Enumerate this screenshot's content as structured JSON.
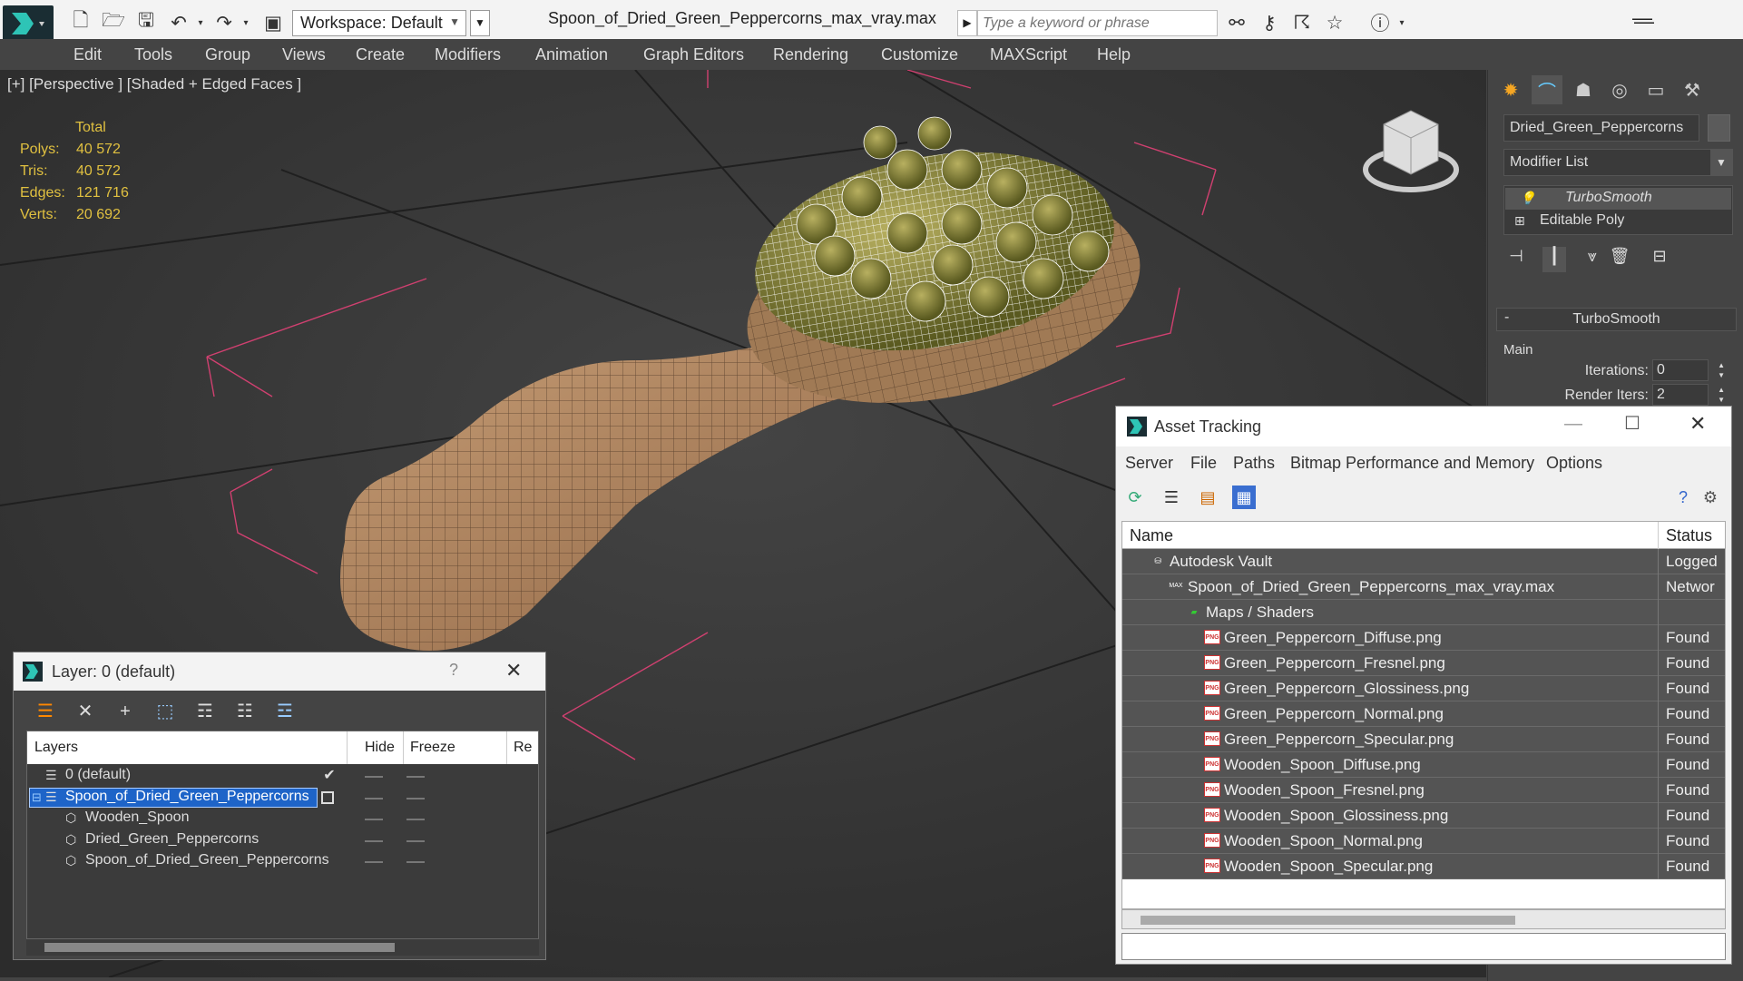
{
  "app": {
    "file_title": "Spoon_of_Dried_Green_Peppercorns_max_vray.max",
    "workspace": "Workspace: Default",
    "search_placeholder": "Type a keyword or phrase"
  },
  "menu": [
    "Edit",
    "Tools",
    "Group",
    "Views",
    "Create",
    "Modifiers",
    "Animation",
    "Graph Editors",
    "Rendering",
    "Customize",
    "MAXScript",
    "Help"
  ],
  "viewport": {
    "label": "[+] [Perspective ] [Shaded + Edged Faces ]",
    "stats": {
      "header": "Total",
      "rows": [
        {
          "label": "Polys:",
          "value": "40 572"
        },
        {
          "label": "Tris:",
          "value": "40 572"
        },
        {
          "label": "Edges:",
          "value": "121 716"
        },
        {
          "label": "Verts:",
          "value": "20 692"
        }
      ]
    }
  },
  "command_panel": {
    "object_name": "Dried_Green_Peppercorns",
    "modifier_list": "Modifier List",
    "stack": [
      "TurboSmooth",
      "Editable Poly"
    ],
    "rollout_title": "TurboSmooth",
    "group_main": "Main",
    "iterations_label": "Iterations:",
    "iterations_value": "0",
    "render_iters_label": "Render Iters:",
    "render_iters_value": "2",
    "render_iters_checked": true
  },
  "asset_tracking": {
    "title": "Asset Tracking",
    "menu": [
      "Server",
      "File",
      "Paths",
      "Bitmap Performance and Memory",
      "Options"
    ],
    "columns": [
      "Name",
      "Status"
    ],
    "rows": [
      {
        "name": "Autodesk Vault",
        "status": "Logged",
        "level": 0,
        "icon": "vault"
      },
      {
        "name": "Spoon_of_Dried_Green_Peppercorns_max_vray.max",
        "status": "Networ",
        "level": 1,
        "icon": "max"
      },
      {
        "name": "Maps / Shaders",
        "status": "",
        "level": 2,
        "icon": "maps"
      },
      {
        "name": "Green_Peppercorn_Diffuse.png",
        "status": "Found",
        "level": 3,
        "icon": "png"
      },
      {
        "name": "Green_Peppercorn_Fresnel.png",
        "status": "Found",
        "level": 3,
        "icon": "png"
      },
      {
        "name": "Green_Peppercorn_Glossiness.png",
        "status": "Found",
        "level": 3,
        "icon": "png"
      },
      {
        "name": "Green_Peppercorn_Normal.png",
        "status": "Found",
        "level": 3,
        "icon": "png"
      },
      {
        "name": "Green_Peppercorn_Specular.png",
        "status": "Found",
        "level": 3,
        "icon": "png"
      },
      {
        "name": "Wooden_Spoon_Diffuse.png",
        "status": "Found",
        "level": 3,
        "icon": "png"
      },
      {
        "name": "Wooden_Spoon_Fresnel.png",
        "status": "Found",
        "level": 3,
        "icon": "png"
      },
      {
        "name": "Wooden_Spoon_Glossiness.png",
        "status": "Found",
        "level": 3,
        "icon": "png"
      },
      {
        "name": "Wooden_Spoon_Normal.png",
        "status": "Found",
        "level": 3,
        "icon": "png"
      },
      {
        "name": "Wooden_Spoon_Specular.png",
        "status": "Found",
        "level": 3,
        "icon": "png"
      }
    ]
  },
  "layer_window": {
    "title": "Layer: 0 (default)",
    "help": "?",
    "columns": [
      "Layers",
      "Hide",
      "Freeze",
      "Re"
    ],
    "rows": [
      {
        "name": "0 (default)",
        "level": 0,
        "active": true,
        "selected": false,
        "icon": "layer"
      },
      {
        "name": "Spoon_of_Dried_Green_Peppercorns",
        "level": 0,
        "active": false,
        "selected": true,
        "icon": "layer"
      },
      {
        "name": "Wooden_Spoon",
        "level": 1,
        "active": false,
        "selected": false,
        "icon": "object"
      },
      {
        "name": "Dried_Green_Peppercorns",
        "level": 1,
        "active": false,
        "selected": false,
        "icon": "object"
      },
      {
        "name": "Spoon_of_Dried_Green_Peppercorns",
        "level": 1,
        "active": false,
        "selected": false,
        "icon": "object"
      }
    ]
  }
}
